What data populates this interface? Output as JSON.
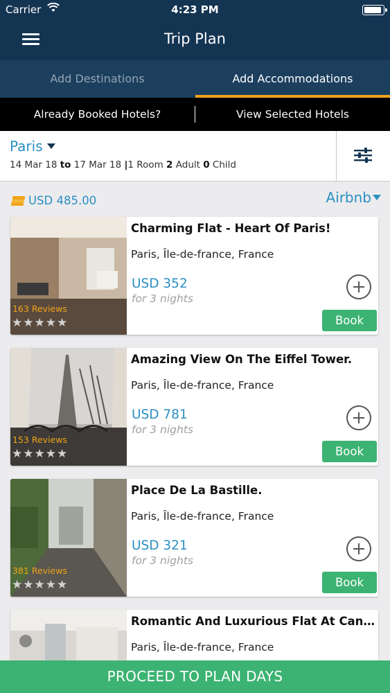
{
  "status_bar": {
    "carrier": "Carrier",
    "time": "4:23 PM"
  },
  "nav": {
    "title": "Trip Plan"
  },
  "tabs": [
    {
      "label": "Add Destinations",
      "active": false
    },
    {
      "label": "Add Accommodations",
      "active": true
    }
  ],
  "booked_bar": {
    "already_booked": "Already Booked Hotels?",
    "view_selected": "View Selected Hotels"
  },
  "search": {
    "city": "Paris",
    "from_date": "14 Mar 18",
    "to_word": "to",
    "to_date": "17 Mar 18",
    "separator": "|",
    "rooms": "1",
    "rooms_label": "Room",
    "adults": "2",
    "adults_label": "Adult",
    "children": "0",
    "children_label": "Child"
  },
  "budget": "USD 485.00",
  "provider": "Airbnb",
  "listings": [
    {
      "title": "Charming Flat - Heart Of Paris!",
      "location": "Paris, Île-de-france, France",
      "price": "USD 352",
      "nights": "for 3 nights",
      "reviews": "163 Reviews",
      "rating": 5,
      "stars": "★★★★★",
      "book_label": "Book"
    },
    {
      "title": "Amazing View On The Eiffel Tower.",
      "location": "Paris, Île-de-france, France",
      "price": "USD 781",
      "nights": "for 3 nights",
      "reviews": "153 Reviews",
      "rating": 5,
      "stars": "★★★★★",
      "book_label": "Book"
    },
    {
      "title": "Place De La Bastille.",
      "location": "Paris, Île-de-france, France",
      "price": "USD 321",
      "nights": "for 3 nights",
      "reviews": "381 Reviews",
      "rating": 5,
      "stars": "★★★★★",
      "book_label": "Book"
    },
    {
      "title": "Romantic And Luxurious Flat At Canal Saint Martin",
      "location": "Paris, Île-de-france, France"
    }
  ],
  "proceed_label": "PROCEED TO PLAN DAYS",
  "colors": {
    "navy": "#143552",
    "tab_bg": "#1c3f5e",
    "accent_orange": "#f0a419",
    "link_blue": "#2b8fc2",
    "green": "#3cb372"
  }
}
